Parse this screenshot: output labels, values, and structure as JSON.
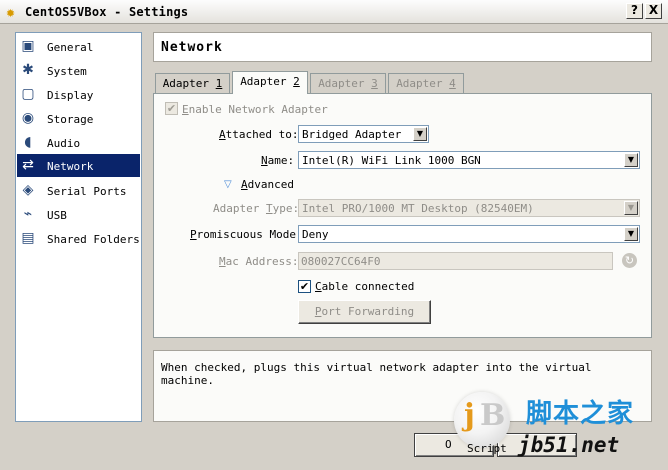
{
  "window": {
    "title": "CentOS5VBox - Settings",
    "help_button": "?",
    "close_button": "X"
  },
  "nav": {
    "items": [
      {
        "label": "General",
        "icon": "general-icon"
      },
      {
        "label": "System",
        "icon": "system-icon"
      },
      {
        "label": "Display",
        "icon": "display-icon"
      },
      {
        "label": "Storage",
        "icon": "storage-icon"
      },
      {
        "label": "Audio",
        "icon": "audio-icon"
      },
      {
        "label": "Network",
        "icon": "network-icon",
        "selected": true
      },
      {
        "label": "Serial Ports",
        "icon": "serial-ports-icon"
      },
      {
        "label": "USB",
        "icon": "usb-icon"
      },
      {
        "label": "Shared Folders",
        "icon": "shared-folders-icon"
      }
    ]
  },
  "page": {
    "title": "Network"
  },
  "tabs": [
    {
      "label_pre": "Adapter ",
      "label_key": "1",
      "active": false,
      "disabled": false
    },
    {
      "label_pre": "Adapter ",
      "label_key": "2",
      "active": true,
      "disabled": false
    },
    {
      "label_pre": "Adapter ",
      "label_key": "3",
      "active": false,
      "disabled": true
    },
    {
      "label_pre": "Adapter ",
      "label_key": "4",
      "active": false,
      "disabled": true
    }
  ],
  "form": {
    "enable_adapter": {
      "key": "E",
      "rest": "nable Network Adapter",
      "checked": true,
      "disabled": true
    },
    "attached_to": {
      "label_key": "A",
      "label_rest": "ttached to:",
      "value": "Bridged Adapter"
    },
    "name": {
      "label_key": "N",
      "label_rest": "ame:",
      "value": "Intel(R) WiFi Link 1000 BGN"
    },
    "advanced": {
      "key": "A",
      "rest": "dvanced"
    },
    "adapter_type": {
      "label_pre": "Adapter ",
      "label_key": "T",
      "label_rest": "ype:",
      "value": "Intel PRO/1000 MT Desktop (82540EM)"
    },
    "promiscuous_mode": {
      "label_key": "P",
      "label_rest": "romiscuous Mode:",
      "value": "Deny"
    },
    "mac_address": {
      "label_key": "M",
      "label_rest": "ac Address:",
      "value": "080027CC64F0"
    },
    "cable_connected": {
      "key": "C",
      "rest": "able connected",
      "checked": true
    },
    "port_forwarding": {
      "key": "P",
      "rest": "ort Forwarding"
    }
  },
  "description": {
    "text": "When checked, plugs this virtual network adapter into the virtual machine."
  },
  "buttons": {
    "ok_partial": "O",
    "script_partial": "Script"
  },
  "watermark": {
    "logo_j": "j",
    "logo_b": "B",
    "cn_text": "脚本之家",
    "url": "jb51.net"
  },
  "colors": {
    "selection": "#0a246a",
    "dialog_bg": "#d4d0c8",
    "watermark_blue": "#1f8fd8",
    "watermark_orange": "#e59a1c"
  }
}
